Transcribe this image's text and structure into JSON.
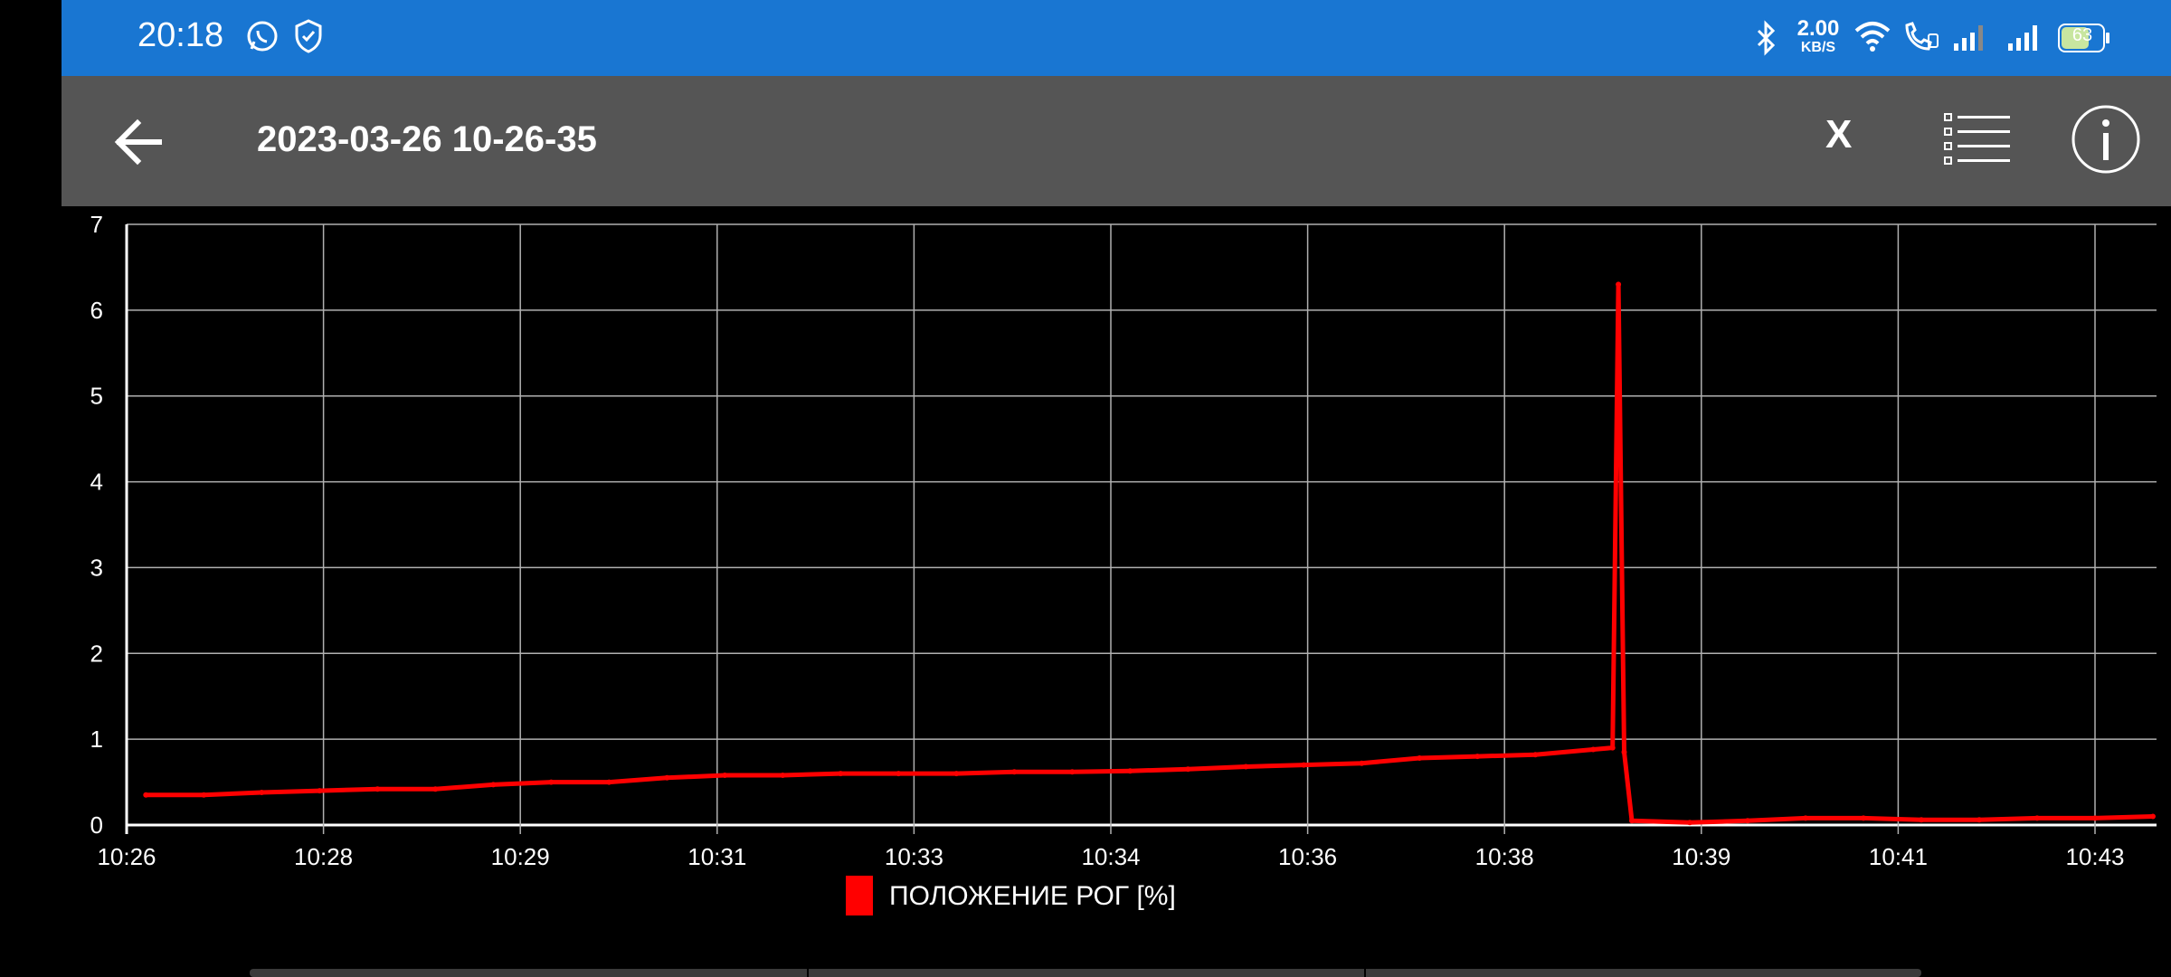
{
  "status_bar": {
    "time": "20:18",
    "left_icons": [
      "whatsapp-icon",
      "shield-check-icon"
    ],
    "net_speed": "2.00",
    "net_speed_unit": "KB/S",
    "battery": "63",
    "right_icons": [
      "bluetooth-icon",
      "wifi-icon",
      "wifi-calling-icon",
      "signal-icon",
      "signal-icon",
      "battery-icon"
    ],
    "color": "#1976d2"
  },
  "app_bar": {
    "title": "2023-03-26 10-26-35",
    "x_label": "X",
    "icons": [
      "arrow-back-icon",
      "list-icon",
      "info-icon"
    ],
    "color": "#555555"
  },
  "chart_data": {
    "type": "line",
    "x_ticks": [
      "10:26",
      "10:28",
      "10:29",
      "10:31",
      "10:33",
      "10:34",
      "10:36",
      "10:38",
      "10:39",
      "10:41",
      "10:43"
    ],
    "y_ticks": [
      "0",
      "1",
      "2",
      "3",
      "4",
      "5",
      "6",
      "7"
    ],
    "ylim": [
      0,
      7
    ],
    "grid": true,
    "legend_position": "bottom-center",
    "series": [
      {
        "name": "ПОЛОЖЕНИЕ РОГ [%]",
        "color": "#ff0000",
        "points": [
          [
            "10:26:10",
            0.35
          ],
          [
            "10:26:40",
            0.35
          ],
          [
            "10:27:10",
            0.38
          ],
          [
            "10:27:40",
            0.4
          ],
          [
            "10:28:10",
            0.42
          ],
          [
            "10:28:40",
            0.42
          ],
          [
            "10:29:10",
            0.47
          ],
          [
            "10:29:40",
            0.5
          ],
          [
            "10:30:10",
            0.5
          ],
          [
            "10:30:40",
            0.55
          ],
          [
            "10:31:10",
            0.58
          ],
          [
            "10:31:40",
            0.58
          ],
          [
            "10:32:10",
            0.6
          ],
          [
            "10:32:40",
            0.6
          ],
          [
            "10:33:10",
            0.6
          ],
          [
            "10:33:40",
            0.62
          ],
          [
            "10:34:10",
            0.62
          ],
          [
            "10:34:40",
            0.63
          ],
          [
            "10:35:10",
            0.65
          ],
          [
            "10:35:40",
            0.68
          ],
          [
            "10:36:10",
            0.7
          ],
          [
            "10:36:40",
            0.72
          ],
          [
            "10:37:10",
            0.78
          ],
          [
            "10:37:40",
            0.8
          ],
          [
            "10:38:10",
            0.82
          ],
          [
            "10:38:40",
            0.88
          ],
          [
            "10:38:50",
            0.9
          ],
          [
            "10:38:53",
            6.3
          ],
          [
            "10:38:56",
            0.85
          ],
          [
            "10:39:00",
            0.05
          ],
          [
            "10:39:30",
            0.03
          ],
          [
            "10:40:00",
            0.05
          ],
          [
            "10:40:30",
            0.08
          ],
          [
            "10:41:00",
            0.08
          ],
          [
            "10:41:30",
            0.06
          ],
          [
            "10:42:00",
            0.06
          ],
          [
            "10:42:30",
            0.08
          ],
          [
            "10:43:00",
            0.08
          ],
          [
            "10:43:30",
            0.1
          ]
        ]
      }
    ]
  }
}
